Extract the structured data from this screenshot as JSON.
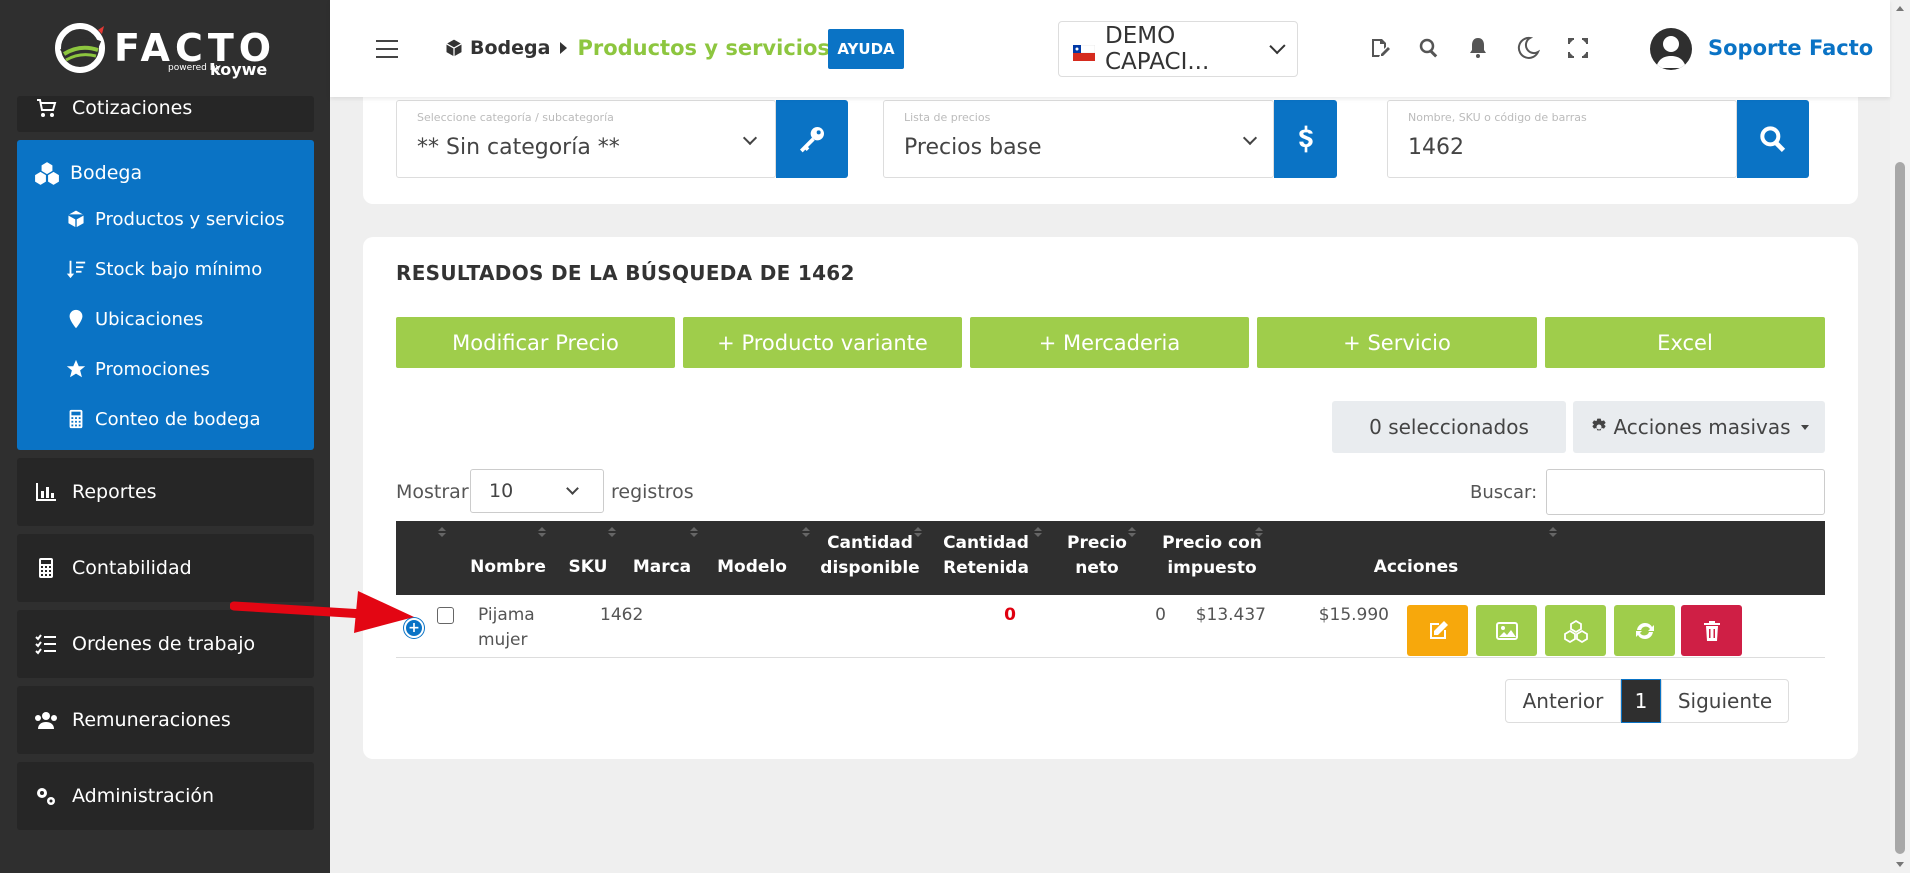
{
  "sidebar": {
    "logo": {
      "word": "FACTO",
      "powered": "powered by",
      "koywe": "koywe"
    },
    "partial_item": "Cotizaciones",
    "bodega": {
      "label": "Bodega",
      "items": [
        {
          "label": "Productos y servicios",
          "icon": "cube-icon"
        },
        {
          "label": "Stock bajo mínimo",
          "icon": "sort-down-icon"
        },
        {
          "label": "Ubicaciones",
          "icon": "map-pin-icon"
        },
        {
          "label": "Promociones",
          "icon": "star-icon"
        },
        {
          "label": "Conteo de bodega",
          "icon": "calculator-icon"
        }
      ]
    },
    "items": [
      {
        "label": "Reportes",
        "icon": "chart-icon"
      },
      {
        "label": "Contabilidad",
        "icon": "calculator-icon"
      },
      {
        "label": "Ordenes de trabajo",
        "icon": "checklist-icon"
      },
      {
        "label": "Remuneraciones",
        "icon": "users-icon"
      },
      {
        "label": "Administración",
        "icon": "gears-icon"
      }
    ]
  },
  "header": {
    "breadcrumb_root": "Bodega",
    "breadcrumb_current": "Productos y servicios",
    "help_label": "AYUDA",
    "company": "DEMO CAPACI...",
    "user_name": "Soporte Facto"
  },
  "filters": {
    "category": {
      "placeholder": "Seleccione categoría / subcategoría",
      "value": "** Sin categoría **"
    },
    "price_list": {
      "placeholder": "Lista de precios",
      "value": "Precios base"
    },
    "search": {
      "placeholder": "Nombre, SKU o código de barras",
      "value": "1462"
    }
  },
  "results": {
    "title": "RESULTADOS DE LA BÚSQUEDA DE 1462",
    "buttons": [
      "Modificar Precio",
      "+ Producto variante",
      "+ Mercaderia",
      "+ Servicio",
      "Excel"
    ],
    "selected_count": "0 seleccionados",
    "mass_actions": "Acciones masivas",
    "show_label": "Mostrar",
    "page_length": "10",
    "records_label": "registros",
    "search_label": "Buscar:",
    "columns": {
      "nombre": "Nombre",
      "sku": "SKU",
      "marca": "Marca",
      "modelo": "Modelo",
      "cant_disp_1": "Cantidad",
      "cant_disp_2": "disponible",
      "cant_ret_1": "Cantidad",
      "cant_ret_2": "Retenida",
      "neto_1": "Precio",
      "neto_2": "neto",
      "imp_1": "Precio con",
      "imp_2": "impuesto",
      "acciones": "Acciones"
    },
    "rows": [
      {
        "nombre_1": "Pijama",
        "nombre_2": "mujer",
        "sku": "1462",
        "marca": "",
        "modelo": "",
        "disponible": "0",
        "retenida": "0",
        "neto": "$13.437",
        "impuesto": "$15.990"
      }
    ],
    "pagination": {
      "prev": "Anterior",
      "current": "1",
      "next": "Siguiente"
    }
  },
  "colors": {
    "brand_blue": "#0a73c5",
    "brand_green": "#8dc63f",
    "button_green": "#9fcd4b",
    "edit_orange": "#f7a80c",
    "delete_red": "#cf1f45",
    "sidebar_dark": "#2f2f2f"
  }
}
